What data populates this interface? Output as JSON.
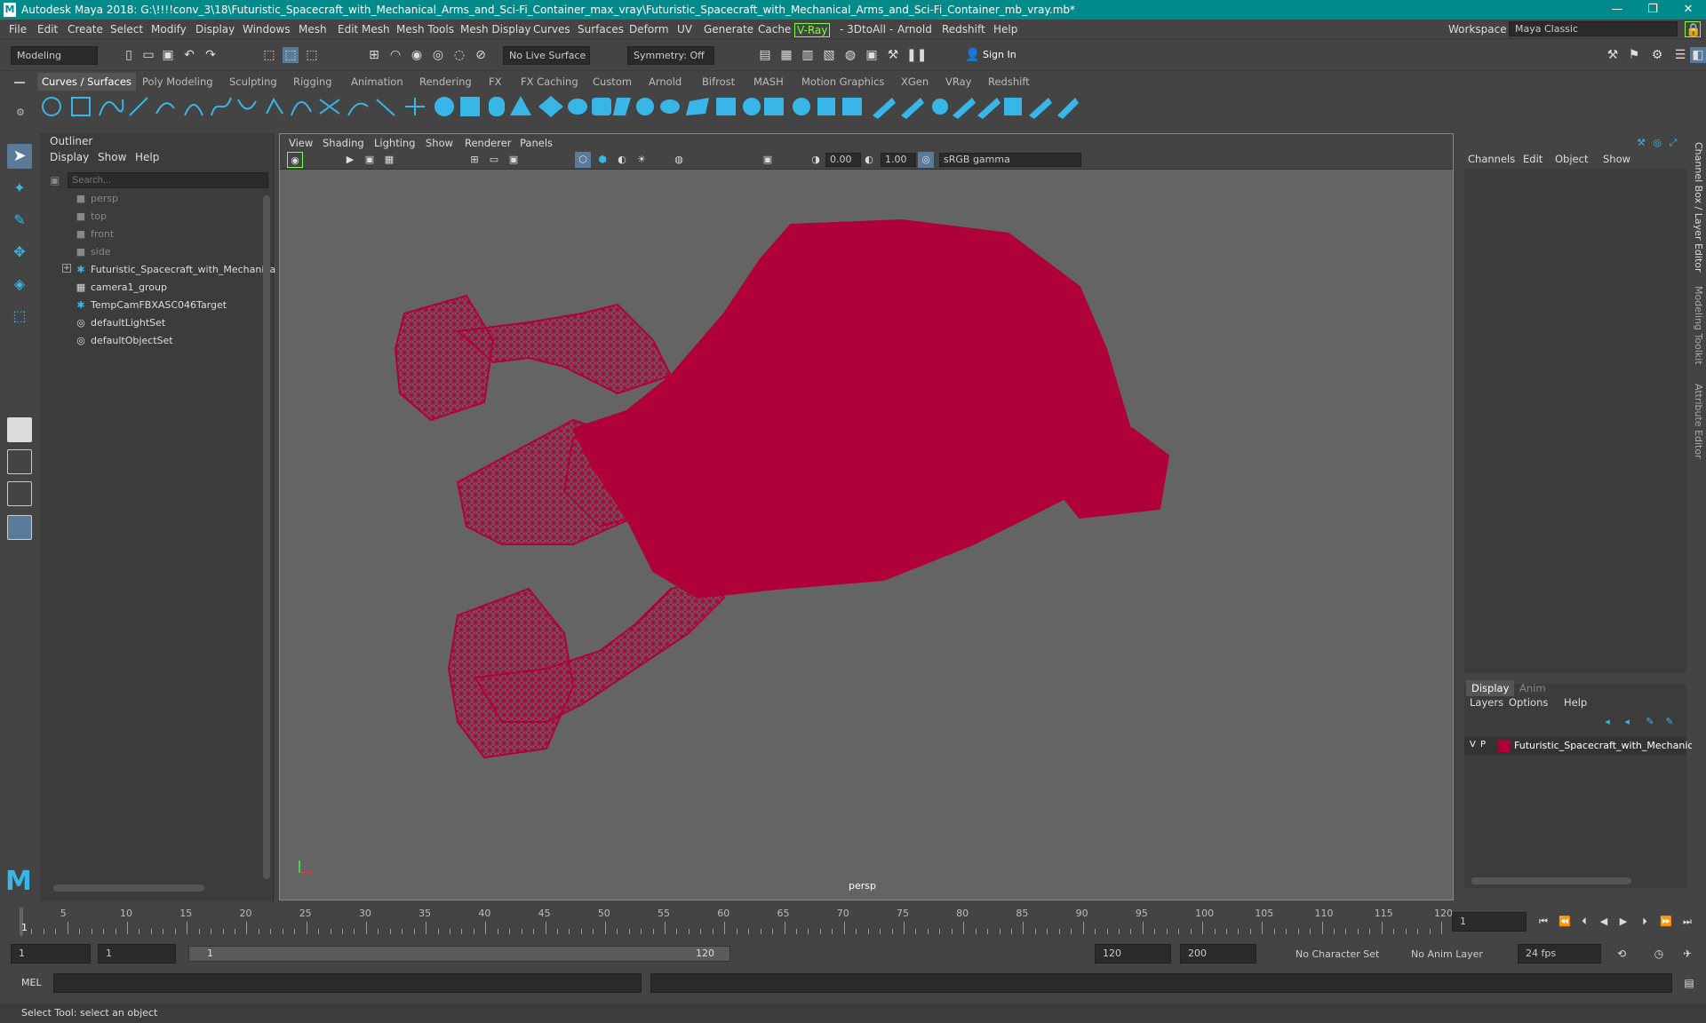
{
  "title": "Autodesk Maya 2018: G:\\!!!!conv_3\\18\\Futuristic_Spacecraft_with_Mechanical_Arms_and_Sci-Fi_Container_max_vray\\Futuristic_Spacecraft_with_Mechanical_Arms_and_Sci-Fi_Container_mb_vray.mb*",
  "menus": [
    "File",
    "Edit",
    "Create",
    "Select",
    "Modify",
    "Display",
    "Windows",
    "Mesh",
    "Edit Mesh",
    "Mesh Tools",
    "Mesh Display",
    "Curves",
    "Surfaces",
    "Deform",
    "UV",
    "Generate",
    "Cache",
    "V-Ray",
    "- 3DtoAll -",
    "Arnold",
    "Redshift",
    "Help"
  ],
  "workspace": {
    "label": "Workspace :",
    "value": "Maya Classic"
  },
  "mode": "Modeling",
  "live_surface": "No Live Surface",
  "symmetry": "Symmetry: Off",
  "sign_in": "Sign In",
  "shelf_tabs": [
    "Curves / Surfaces",
    "Poly Modeling",
    "Sculpting",
    "Rigging",
    "Animation",
    "Rendering",
    "FX",
    "FX Caching",
    "Custom",
    "Arnold",
    "Bifrost",
    "MASH",
    "Motion Graphics",
    "XGen",
    "VRay",
    "Redshift"
  ],
  "outliner": {
    "title": "Outliner",
    "menu": [
      "Display",
      "Show",
      "Help"
    ],
    "search_placeholder": "Search...",
    "items": [
      "persp",
      "top",
      "front",
      "side",
      "Futuristic_Spacecraft_with_Mechanica",
      "camera1_group",
      "TempCamFBXASC046Target",
      "defaultLightSet",
      "defaultObjectSet"
    ]
  },
  "viewport": {
    "menu": [
      "View",
      "Shading",
      "Lighting",
      "Show",
      "Renderer",
      "Panels"
    ],
    "exposure": "0.00",
    "gamma": "1.00",
    "color_space": "sRGB gamma",
    "camera": "persp",
    "wire_color": "#b0003a"
  },
  "channel_box": {
    "menu": [
      "Channels",
      "Edit",
      "Object",
      "Show"
    ]
  },
  "layer_editor": {
    "tabs": [
      "Display",
      "Anim"
    ],
    "menu": [
      "Layers",
      "Options",
      "Help"
    ],
    "layer": {
      "v": "V",
      "p": "P",
      "name": "Futuristic_Spacecraft_with_Mechanic",
      "color": "#b0003a"
    }
  },
  "side_tabs": [
    "Channel Box / Layer Editor",
    "Modeling Toolkit",
    "Attribute Editor"
  ],
  "timeline": {
    "ticks": [
      "5",
      "10",
      "15",
      "20",
      "25",
      "30",
      "35",
      "40",
      "45",
      "50",
      "55",
      "60",
      "65",
      "70",
      "75",
      "80",
      "85",
      "90",
      "95",
      "100",
      "105",
      "110",
      "115",
      "120"
    ],
    "current": "1",
    "current_field": "1"
  },
  "range": {
    "start": "1",
    "start2": "1",
    "slider_start": "1",
    "slider_end": "120",
    "end": "120",
    "end2": "200",
    "char_set": "No Character Set",
    "anim_layer": "No Anim Layer",
    "fps": "24 fps"
  },
  "cmd": {
    "label": "MEL"
  },
  "help_text": "Select Tool: select an object"
}
